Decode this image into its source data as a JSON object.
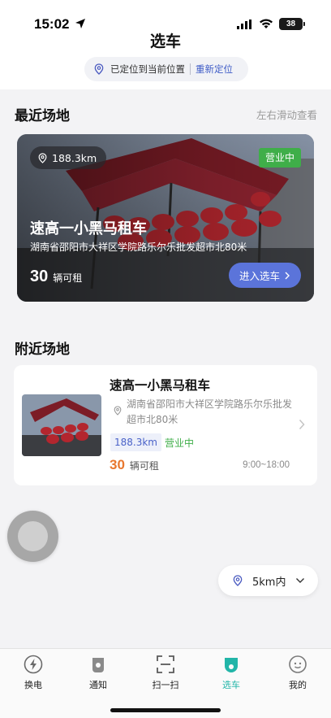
{
  "status_bar": {
    "time": "15:02",
    "battery": "38"
  },
  "header": {
    "title": "选车",
    "location_status": "已定位到当前位置",
    "relocate_label": "重新定位"
  },
  "recent": {
    "title": "最近场地",
    "hint": "左右滑动查看",
    "card": {
      "distance": "188.3km",
      "open_status": "营业中",
      "name": "速高一小黑马租车",
      "address": "湖南省邵阳市大祥区学院路乐尔乐批发超市北80米",
      "available_count": "30",
      "available_unit": "辆可租",
      "enter_button": "进入选车"
    }
  },
  "nearby": {
    "title": "附近场地",
    "items": [
      {
        "name": "速高一小黑马租车",
        "address": "湖南省邵阳市大祥区学院路乐尔乐批发超市北80米",
        "distance": "188.3km",
        "open_status": "营业中",
        "available_count": "30",
        "available_unit": "辆可租",
        "hours": "9:00~18:00"
      }
    ]
  },
  "range_selector": {
    "value": "5km内"
  },
  "tabbar": {
    "tabs": [
      {
        "label": "换电",
        "icon": "lightning-icon"
      },
      {
        "label": "通知",
        "icon": "bell-icon"
      },
      {
        "label": "扫一扫",
        "icon": "scan-icon"
      },
      {
        "label": "选车",
        "icon": "scooter-icon",
        "active": true
      },
      {
        "label": "我的",
        "icon": "profile-icon"
      }
    ]
  },
  "colors": {
    "accent": "#5b74da",
    "tab_active": "#22b5a8",
    "open_green": "#3fae49",
    "count_orange": "#e8772e"
  }
}
